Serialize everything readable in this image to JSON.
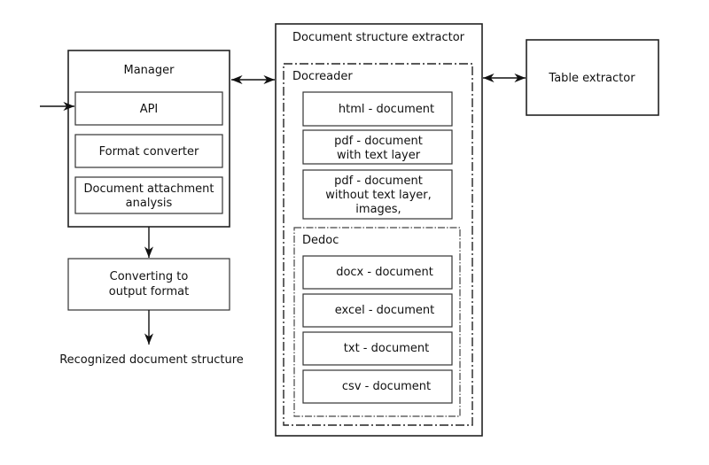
{
  "manager": {
    "title": "Manager",
    "items": [
      "API",
      "Format converter",
      [
        "Document attachment",
        "analysis"
      ]
    ]
  },
  "converter": {
    "lines": [
      "Converting to",
      "output format"
    ]
  },
  "output_label": "Recognized document structure",
  "extractor": {
    "title": "Document structure extractor",
    "docreader": {
      "title": "Docreader",
      "items": [
        [
          "html - document"
        ],
        [
          "pdf - document",
          "with text layer"
        ],
        [
          "pdf - document",
          "without text layer,",
          "images,"
        ]
      ]
    },
    "dedoc": {
      "title": "Dedoc",
      "items": [
        "docx - document",
        "excel - document",
        "txt - document",
        "csv - document"
      ]
    }
  },
  "table_extractor": "Table extractor"
}
